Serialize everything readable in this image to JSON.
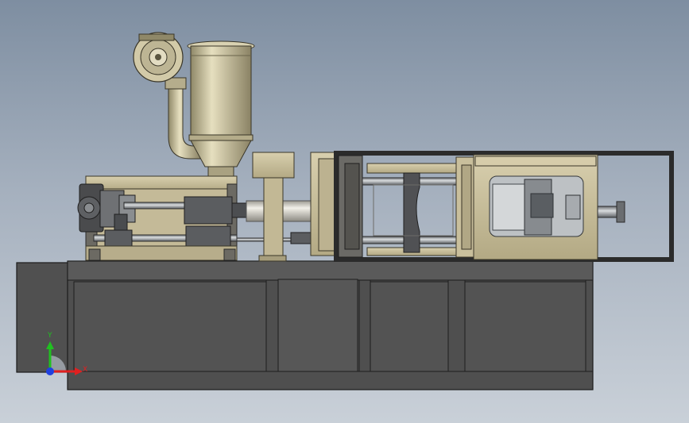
{
  "viewport": {
    "background_top": "#7e8ea1",
    "background_bottom": "#c9d0d8"
  },
  "colors": {
    "base_dark": "#4e4e4e",
    "base_edge": "#1b1b1b",
    "frame_beige": "#c7bd9b",
    "frame_dark": "#5c5a54",
    "steel": "#8a8f93",
    "steel_light": "#c8cccf",
    "hopper": "#cfc7a3"
  },
  "triad": {
    "x_label": "X",
    "y_label": "Y",
    "x_color": "#e02020",
    "y_color": "#20c020",
    "z_color": "#2040e0"
  }
}
